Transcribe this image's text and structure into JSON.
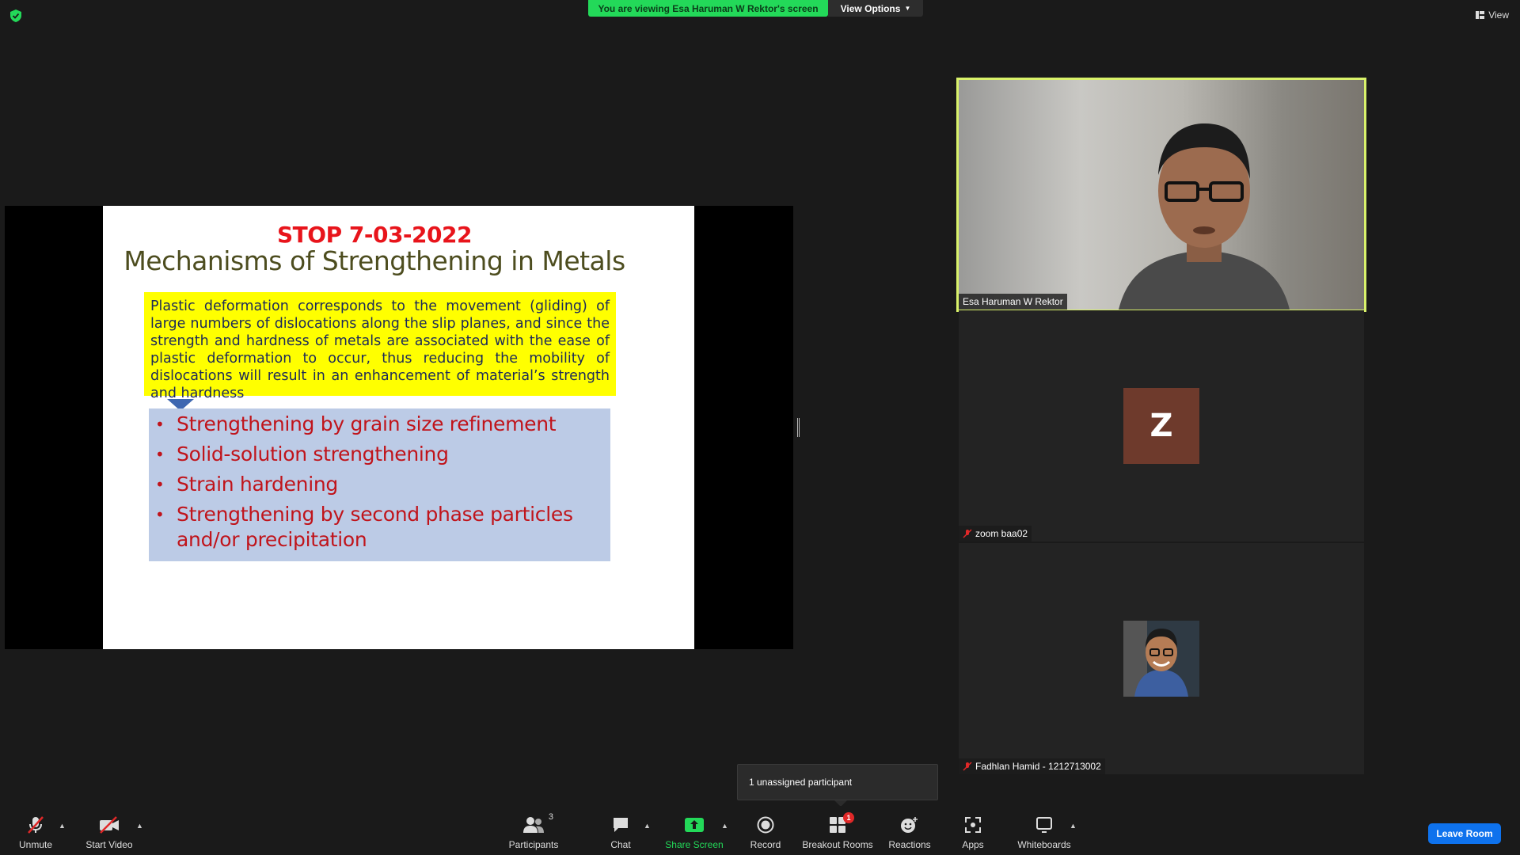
{
  "header": {
    "banner_text": "You are viewing Esa Haruman W Rektor's screen",
    "view_options_label": "View Options",
    "view_label": "View"
  },
  "slide": {
    "stop_text": "STOP 7-03-2022",
    "title": "Mechanisms of Strengthening in Metals",
    "paragraph": "Plastic deformation corresponds to the movement (gliding) of large numbers of dislocations along the slip planes, and since the strength and hardness of metals are associated with the ease of plastic deformation to occur, thus reducing the mobility of dislocations will result in an enhancement of material’s strength and hardness",
    "bullets": [
      "Strengthening by grain size refinement",
      "Solid-solution strengthening",
      "Strain hardening",
      "Strengthening by second phase particles and/or precipitation"
    ],
    "bullet_symbol": "•"
  },
  "participants": [
    {
      "name": "Esa Haruman W Rektor",
      "video": true
    },
    {
      "name": "zoom baa02",
      "avatar_letter": "Z",
      "muted": true
    },
    {
      "name": "Fadhlan Hamid - 1212713002",
      "muted": true
    }
  ],
  "tooltip": {
    "text": "1 unassigned participant"
  },
  "toolbar": {
    "unmute": "Unmute",
    "start_video": "Start Video",
    "participants": "Participants",
    "participants_count": "3",
    "chat": "Chat",
    "share_screen": "Share Screen",
    "record": "Record",
    "breakout_rooms": "Breakout Rooms",
    "breakout_badge": "1",
    "reactions": "Reactions",
    "apps": "Apps",
    "whiteboards": "Whiteboards",
    "leave_room": "Leave Room"
  },
  "colors": {
    "banner_green": "#23d959",
    "active_speaker_border": "#d9f26a",
    "leave_blue": "#0e72ed",
    "slide_red": "#e8141b",
    "avatar_brown": "#6e3a2c"
  }
}
